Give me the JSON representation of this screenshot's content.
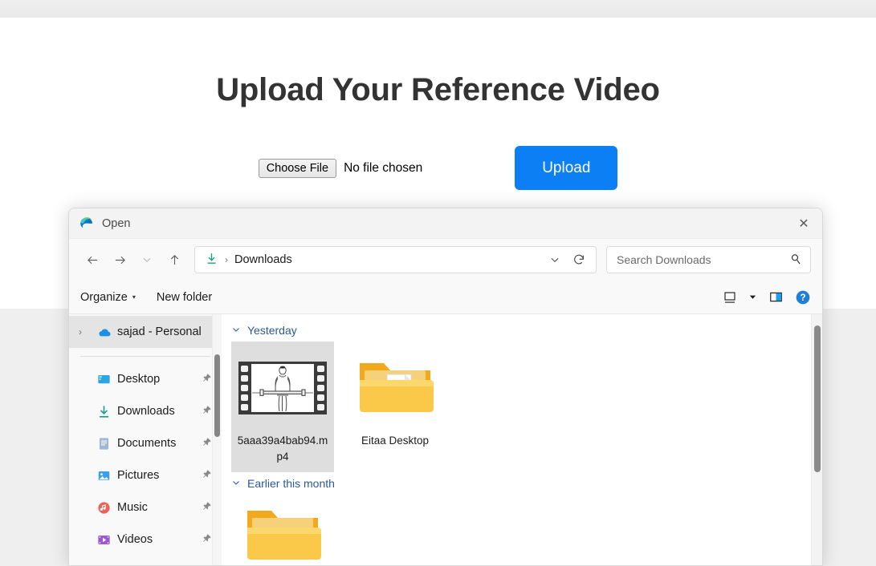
{
  "page": {
    "title": "Upload Your Reference Video",
    "file_input": {
      "button_label": "Choose File",
      "status_text": "No file chosen"
    },
    "upload_button_label": "Upload",
    "accent_color": "#0d7ff5"
  },
  "dialog": {
    "title": "Open",
    "app_icon": "edge-icon",
    "close_label": "✕",
    "nav": {
      "back_icon": "arrow-left-icon",
      "forward_icon": "arrow-right-icon",
      "recent_icon": "chevron-down-icon",
      "up_icon": "arrow-up-icon"
    },
    "address": {
      "location_icon": "downloads-icon",
      "separator": "›",
      "crumb": "Downloads",
      "history_icon": "chevron-down-icon",
      "refresh_icon": "refresh-icon"
    },
    "search": {
      "placeholder": "Search Downloads",
      "icon": "search-icon"
    },
    "commandbar": {
      "organize_label": "Organize",
      "organize_caret": "▾",
      "new_folder_label": "New folder",
      "view_icon": "view-layout-icon",
      "view_caret": "▾",
      "preview_pane_icon": "preview-pane-icon",
      "help_icon": "help-icon",
      "help_glyph": "?"
    },
    "sidebar": {
      "account": {
        "label": "sajad - Personal",
        "icon": "onedrive-cloud-icon",
        "chevron": "›",
        "selected": true
      },
      "items": [
        {
          "label": "Desktop",
          "icon": "desktop-icon",
          "pinned": true
        },
        {
          "label": "Downloads",
          "icon": "downloads-icon",
          "pinned": true
        },
        {
          "label": "Documents",
          "icon": "documents-icon",
          "pinned": true
        },
        {
          "label": "Pictures",
          "icon": "pictures-icon",
          "pinned": true
        },
        {
          "label": "Music",
          "icon": "music-icon",
          "pinned": true
        },
        {
          "label": "Videos",
          "icon": "videos-icon",
          "pinned": true
        }
      ],
      "pin_glyph": "📌"
    },
    "filelist": {
      "groups": [
        {
          "header": "Yesterday",
          "chevron": "⌄",
          "items": [
            {
              "name": "5aaa39a4bab94.mp4",
              "type": "video",
              "selected": true
            },
            {
              "name": "Eitaa Desktop",
              "type": "folder",
              "selected": false
            }
          ]
        },
        {
          "header": "Earlier this month",
          "chevron": "⌄",
          "items": [
            {
              "name": "",
              "type": "folder",
              "selected": false
            }
          ]
        }
      ]
    }
  }
}
